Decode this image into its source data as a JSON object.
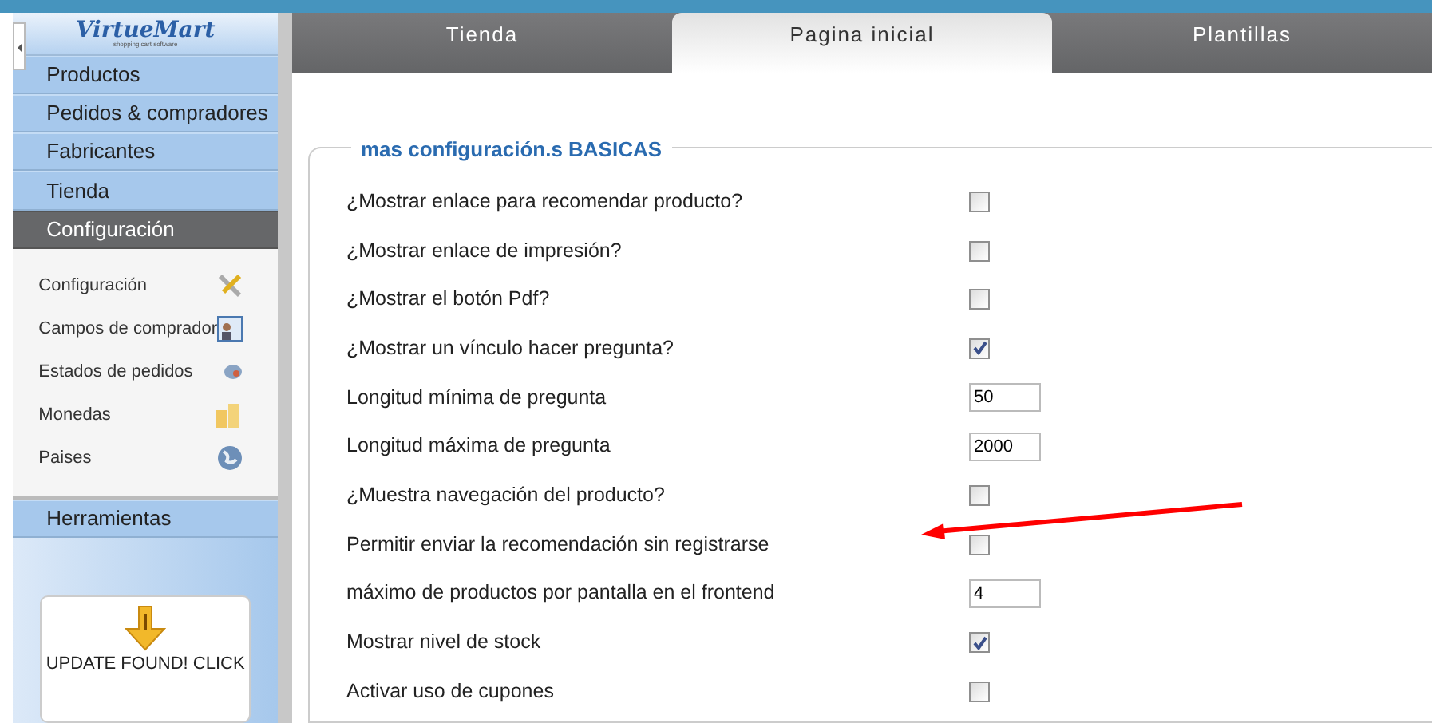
{
  "sidebar": {
    "logo": {
      "name": "VirtueMart",
      "tagline": "shopping cart software"
    },
    "menu": [
      {
        "label": "Productos",
        "selected": false
      },
      {
        "label": "Pedidos & compradores",
        "selected": false
      },
      {
        "label": "Fabricantes",
        "selected": false
      },
      {
        "label": "Tienda",
        "selected": false
      },
      {
        "label": "Configuración",
        "selected": true
      }
    ],
    "submenu": [
      {
        "label": "Configuración"
      },
      {
        "label": "Campos de comprador"
      },
      {
        "label": "Estados de pedidos"
      },
      {
        "label": "Monedas"
      },
      {
        "label": "Paises"
      }
    ],
    "menu_after": [
      {
        "label": "Herramientas",
        "selected": false
      }
    ],
    "update_notice": {
      "text": "UPDATE FOUND! CLICK"
    }
  },
  "tabs": [
    {
      "label": "Tienda",
      "selected": false
    },
    {
      "label": "Pagina inicial",
      "selected": true
    },
    {
      "label": "Plantillas",
      "selected": false
    }
  ],
  "fieldset": {
    "legend": "mas configuración.s BASICAS",
    "rows": [
      {
        "label": "¿Mostrar enlace para recomendar producto?",
        "kind": "checkbox",
        "checked": false
      },
      {
        "label": "¿Mostrar enlace de impresión?",
        "kind": "checkbox",
        "checked": false
      },
      {
        "label": "¿Mostrar el botón Pdf?",
        "kind": "checkbox",
        "checked": false
      },
      {
        "label": "¿Mostrar un vínculo hacer pregunta?",
        "kind": "checkbox",
        "checked": true
      },
      {
        "label": "Longitud mínima de pregunta",
        "kind": "number",
        "value": "50"
      },
      {
        "label": "Longitud máxima de pregunta",
        "kind": "number",
        "value": "2000"
      },
      {
        "label": "¿Muestra navegación del producto?",
        "kind": "checkbox",
        "checked": false
      },
      {
        "label": "Permitir enviar la recomendación sin registrarse",
        "kind": "checkbox",
        "checked": false
      },
      {
        "label": "máximo de productos por pantalla en el frontend",
        "kind": "number",
        "value": "4"
      },
      {
        "label": "Mostrar nivel de stock",
        "kind": "checkbox",
        "checked": true
      },
      {
        "label": "Activar uso de cupones",
        "kind": "checkbox",
        "checked": false
      }
    ]
  }
}
